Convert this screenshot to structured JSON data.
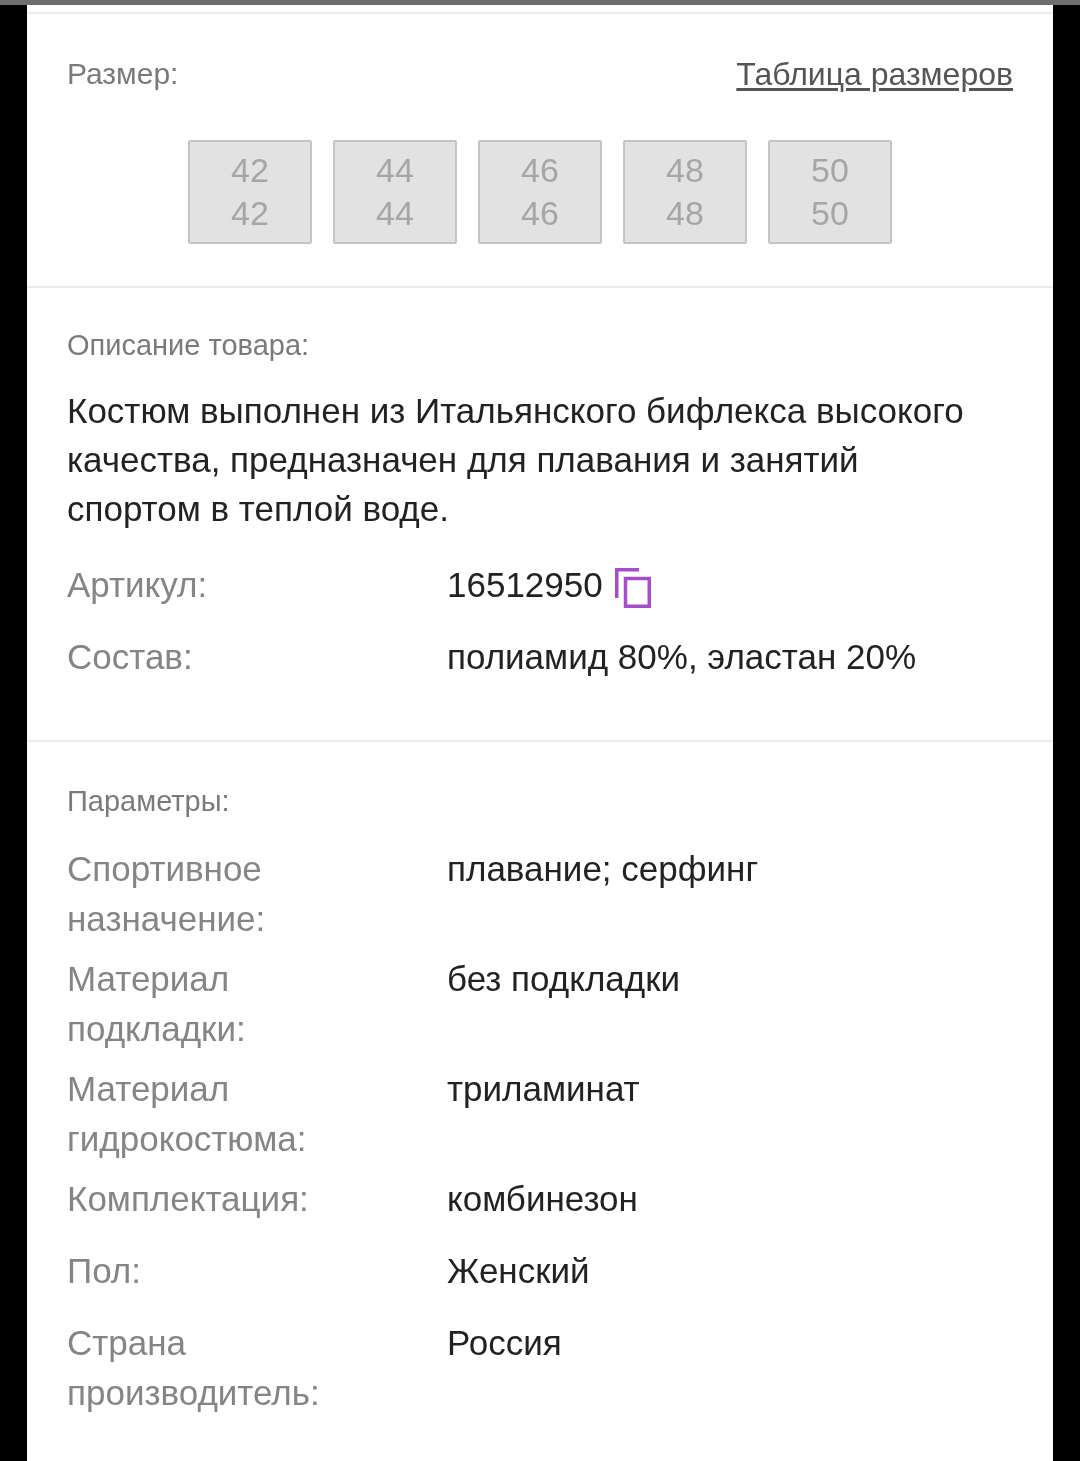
{
  "size_section": {
    "label": "Размер:",
    "chart_link": "Таблица размеров",
    "sizes": [
      {
        "lines": [
          "42",
          "42"
        ],
        "disabled": true
      },
      {
        "lines": [
          "44",
          "44"
        ],
        "disabled": true
      },
      {
        "lines": [
          "46",
          "46"
        ],
        "disabled": true
      },
      {
        "lines": [
          "48",
          "48"
        ],
        "disabled": true
      },
      {
        "lines": [
          "50",
          "50"
        ],
        "disabled": true
      }
    ]
  },
  "description": {
    "label": "Описание товара:",
    "text": "Костюм выполнен из Итальянского бифлекса высокого качества, предназначен для плавания и занятий спортом в теплой воде.",
    "attributes": [
      {
        "label": "Артикул:",
        "value": "16512950",
        "copyable": true
      },
      {
        "label": "Состав:",
        "value": "полиамид 80%, эластан 20%",
        "copyable": false
      }
    ]
  },
  "parameters": {
    "label": "Параметры:",
    "rows": [
      {
        "label": "Спортивное назначение:",
        "value": "плавание; серфинг"
      },
      {
        "label": "Материал подкладки:",
        "value": "без подкладки"
      },
      {
        "label": "Материал гидрокостюма:",
        "value": "триламинат"
      },
      {
        "label": "Комплектация:",
        "value": "комбинезон"
      },
      {
        "label": "Пол:",
        "value": "Женский"
      },
      {
        "label": "Страна производитель:",
        "value": "Россия"
      }
    ]
  }
}
